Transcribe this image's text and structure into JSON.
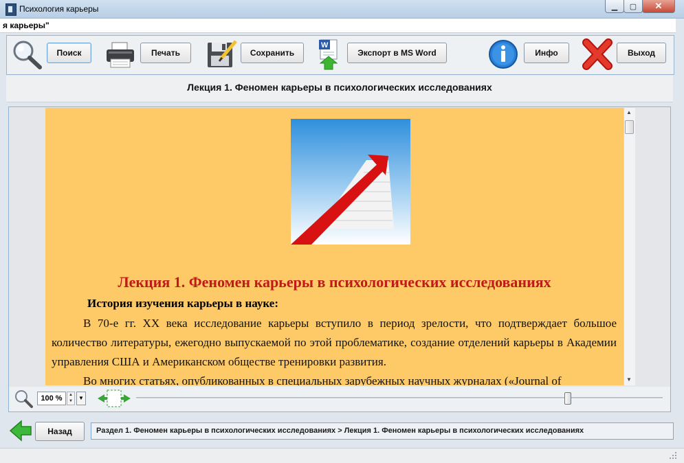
{
  "window": {
    "title": "Психология карьеры",
    "subtitle_truncated": "я карьеры\"",
    "controls": {
      "minimize": "▁",
      "maximize": "▢",
      "close": "✕"
    }
  },
  "toolbar": {
    "search_label": "Поиск",
    "print_label": "Печать",
    "save_label": "Сохранить",
    "export_label": "Экспорт в MS Word",
    "info_label": "Инфо",
    "exit_label": "Выход",
    "icons": [
      "magnifier-icon",
      "printer-icon",
      "floppy-save-icon",
      "word-export-icon",
      "info-icon",
      "red-x-icon"
    ]
  },
  "lecture_header": "Лекция 1. Феномен карьеры в психологических исследованиях",
  "document": {
    "image": "stairs-red-carpet-arrow",
    "heading": "Лекция 1. Феномен карьеры в психологических исследованиях",
    "subheading": "История изучения карьеры в науке:",
    "paragraphs": [
      "В 70-е гг. XX века исследование карьеры вступило в период зрелости, что подтверждает большое количество литературы, ежегодно выпускаемой по этой проблематике, создание отделений карьеры в Академии управления США и Американском обществе тренировки развития.",
      "Во многих статьях, опубликованных в специальных зарубежных научных журналах («Journal of"
    ],
    "colors": {
      "page_background": "#fec967",
      "heading": "#c01a1a"
    }
  },
  "zoom": {
    "value": "100 %",
    "slider_position": 0.82
  },
  "navigation": {
    "back_label": "Назад",
    "breadcrumb": "Раздел 1. Феномен карьеры в психологических  исследованиях  >  Лекция 1. Феномен карьеры в психологических исследованиях"
  }
}
